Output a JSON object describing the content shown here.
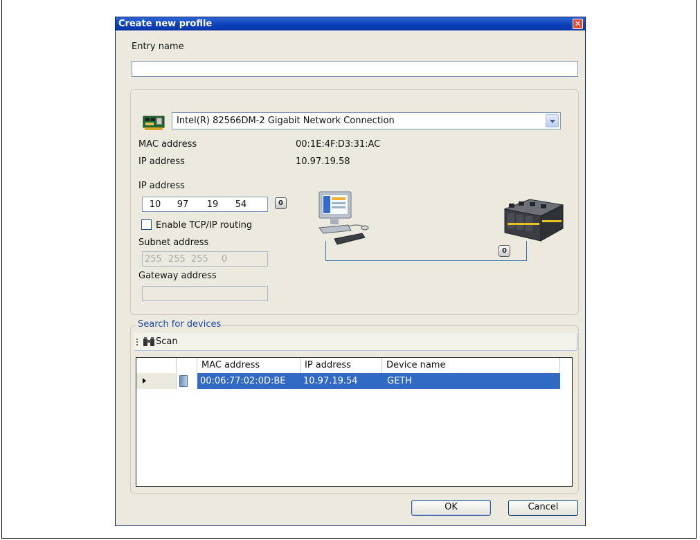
{
  "window": {
    "title": "Create new profile",
    "close_label": "✕"
  },
  "entry": {
    "label": "Entry name",
    "value": ""
  },
  "adapter": {
    "selected": "Intel(R) 82566DM-2 Gigabit Network Connection",
    "mac_label": "MAC address",
    "mac_value": "00:1E:4F:D3:31:AC",
    "ip_label": "IP address",
    "ip_value": "10.97.19.58"
  },
  "config": {
    "ip_label": "IP address",
    "ip": [
      "10",
      "97",
      "19",
      "54"
    ],
    "reset_label": "0",
    "routing_label": "Enable TCP/IP routing",
    "routing_checked": false,
    "subnet_label": "Subnet address",
    "subnet": [
      "255",
      "255",
      "255",
      "0"
    ],
    "gateway_label": "Gateway address",
    "gateway": "",
    "device_badge": "0"
  },
  "search": {
    "legend": "Search for devices",
    "scan_label": "Scan",
    "columns": [
      "MAC address",
      "IP address",
      "Device name"
    ],
    "rows": [
      {
        "mac": "00:06:77:02:0D:BE",
        "ip": "10.97.19.54",
        "name": "GETH",
        "selected": true
      }
    ]
  },
  "buttons": {
    "ok": "OK",
    "cancel": "Cancel"
  },
  "colors": {
    "titlebar": "#0a3fb8",
    "selection": "#316ac5",
    "dialog_bg": "#eceadf",
    "legend": "#1b48a8"
  }
}
